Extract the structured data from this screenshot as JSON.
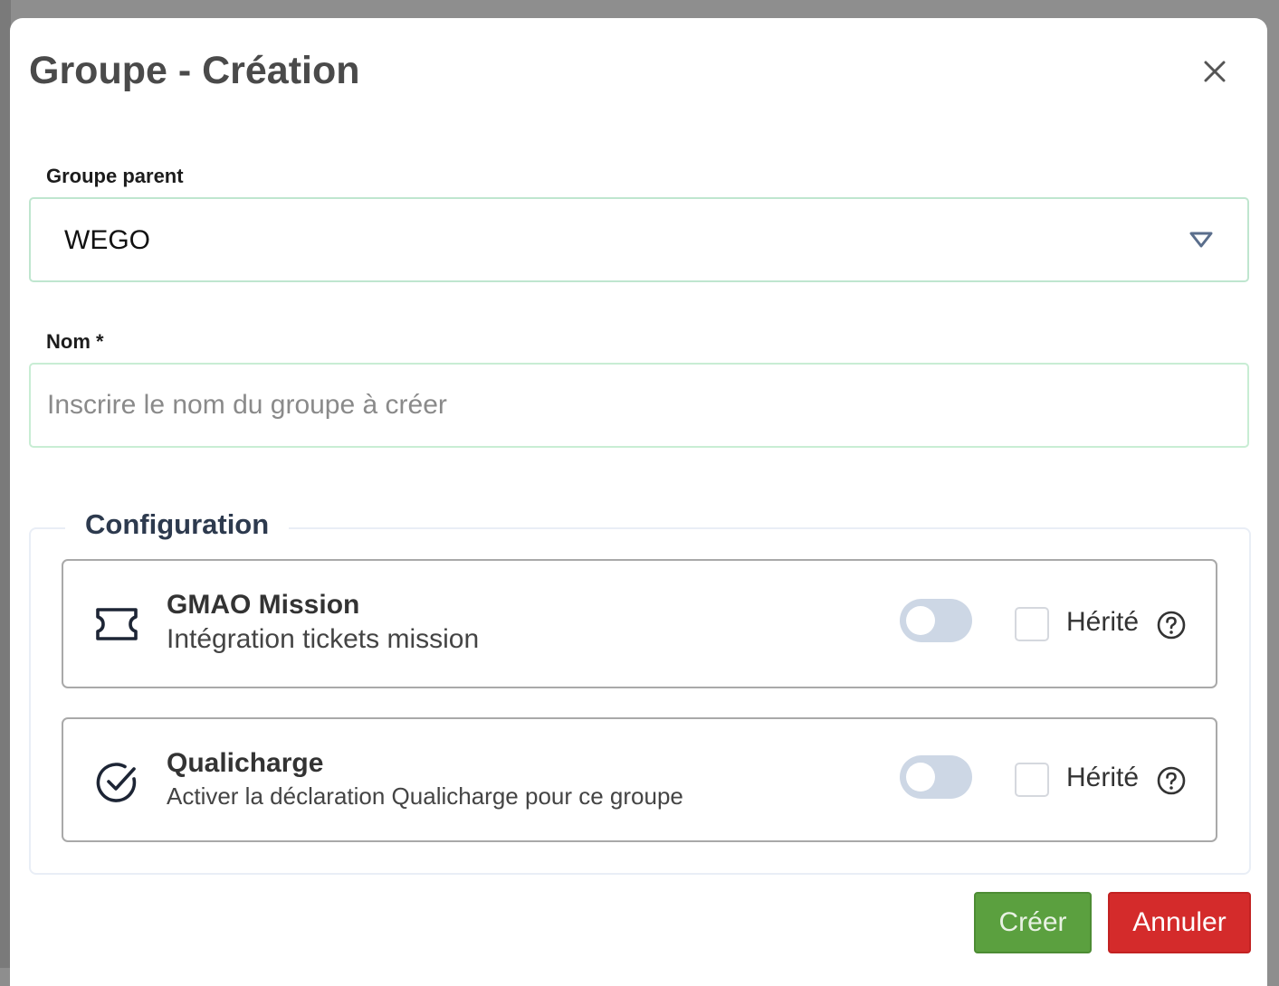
{
  "modal": {
    "title": "Groupe - Création",
    "close_icon": "close-icon"
  },
  "parent_group": {
    "label": "Groupe parent",
    "value": "WEGO",
    "arrow_icon": "dropdown-triangle-icon"
  },
  "name": {
    "label": "Nom *",
    "value": "",
    "placeholder": "Inscrire le nom du groupe à créer"
  },
  "configuration": {
    "legend": "Configuration",
    "items": [
      {
        "icon": "ticket-icon",
        "title": "GMAO Mission",
        "description": "Intégration tickets mission",
        "enabled": false,
        "inherited": false,
        "inherited_label": "Hérité",
        "help_icon": "help-circle-icon"
      },
      {
        "icon": "check-circle-icon",
        "title": "Qualicharge",
        "description": "Activer la déclaration Qualicharge pour ce groupe",
        "enabled": false,
        "inherited": false,
        "inherited_label": "Hérité",
        "help_icon": "help-circle-icon"
      }
    ]
  },
  "actions": {
    "create_label": "Créer",
    "cancel_label": "Annuler"
  },
  "colors": {
    "create_button": "#5ba03f",
    "cancel_button": "#d42b2b",
    "input_border": "#bfe6cf",
    "toggle_off": "#cdd7e5"
  }
}
